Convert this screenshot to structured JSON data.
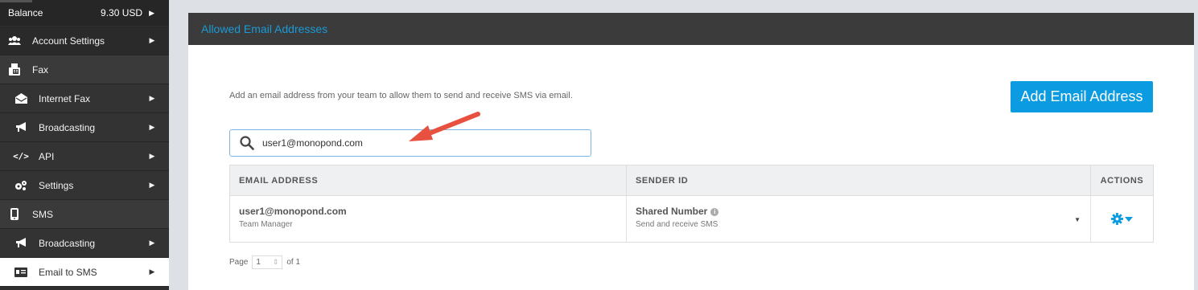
{
  "sidebar": {
    "balance": {
      "label": "Balance",
      "value": "9.30 USD"
    },
    "items": [
      {
        "label": "Account Settings",
        "icon": "users-icon",
        "has_chevron": true
      },
      {
        "label": "Fax",
        "icon": "fax-icon",
        "has_chevron": false
      },
      {
        "label": "Internet Fax",
        "icon": "envelope-open-icon",
        "has_chevron": true
      },
      {
        "label": "Broadcasting",
        "icon": "bullhorn-icon",
        "has_chevron": true
      },
      {
        "label": "API",
        "icon": "code-icon",
        "has_chevron": true
      },
      {
        "label": "Settings",
        "icon": "gears-icon",
        "has_chevron": true
      },
      {
        "label": "SMS",
        "icon": "mobile-icon",
        "has_chevron": false
      },
      {
        "label": "Broadcasting",
        "icon": "bullhorn-icon",
        "has_chevron": true
      },
      {
        "label": "Email to SMS",
        "icon": "id-card-icon",
        "has_chevron": true,
        "active": true
      }
    ]
  },
  "panel": {
    "title": "Allowed Email Addresses",
    "intro": "Add an email address from your team to allow them to send and receive SMS via email.",
    "add_button": "Add Email Address",
    "search": {
      "value": "user1@monopond.com",
      "placeholder": ""
    }
  },
  "table": {
    "headers": [
      "EMAIL ADDRESS",
      "SENDER ID",
      "ACTIONS"
    ],
    "rows": [
      {
        "email": "user1@monopond.com",
        "role": "Team Manager",
        "sender": "Shared Number",
        "sender_desc": "Send and receive SMS"
      }
    ]
  },
  "pager": {
    "prefix": "Page",
    "current": "1",
    "suffix": "of 1"
  },
  "colors": {
    "accent": "#0a9be0",
    "sidebar_bg": "#2f2f2f",
    "panel_header_bg": "#3b3b3b",
    "annotation_arrow": "#e8503f"
  }
}
